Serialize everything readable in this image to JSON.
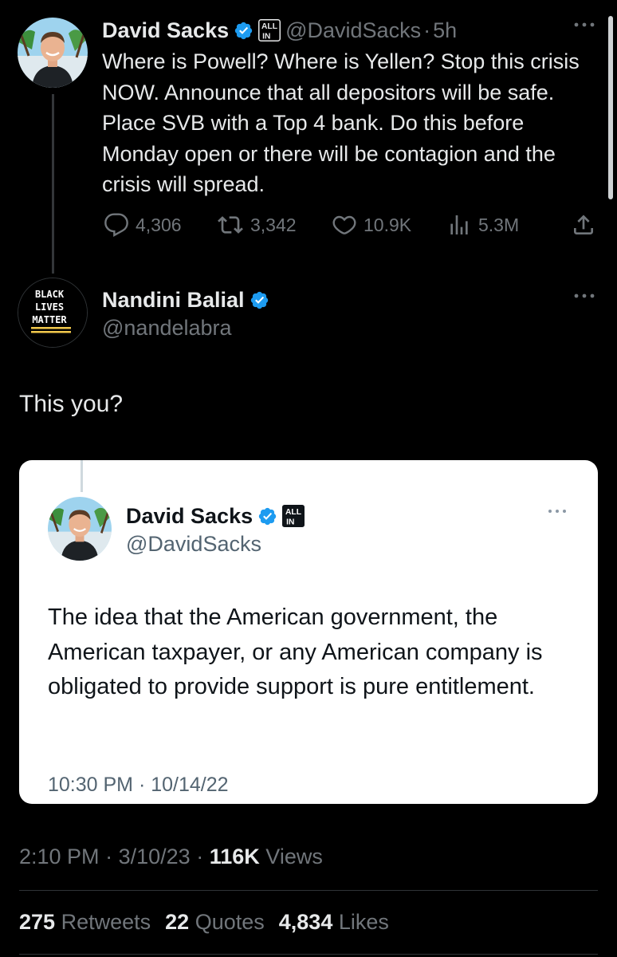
{
  "parent_tweet": {
    "author_name": "David Sacks",
    "badge_label": "ALL IN",
    "handle": "@DavidSacks",
    "separator": "·",
    "time_ago": "5h",
    "text": "Where is Powell? Where is Yellen? Stop this crisis NOW. Announce that all depositors will be safe. Place SVB with a Top 4 bank. Do this before Monday open or there will be contagion and the crisis will spread.",
    "replies": "4,306",
    "retweets": "3,342",
    "likes": "10.9K",
    "views": "5.3M"
  },
  "main_tweet": {
    "author_name": "Nandini Balial",
    "handle": "@nandelabra",
    "avatar_text": [
      "BLACK",
      "LIVES",
      "MATTER"
    ],
    "text": "This you?",
    "time": "2:10 PM",
    "date": "3/10/23",
    "views_count": "116K",
    "views_label": "Views",
    "separator": "·"
  },
  "embedded_tweet": {
    "author_name": "David Sacks",
    "badge_label": "ALL IN",
    "handle": "@DavidSacks",
    "text": "The idea that the American government, the American taxpayer, or any American company is obligated to provide support is pure entitlement.",
    "timestamp": "10:30 PM · 10/14/22"
  },
  "stats": {
    "retweets_count": "275",
    "retweets_label": "Retweets",
    "quotes_count": "22",
    "quotes_label": "Quotes",
    "likes_count": "4,834",
    "likes_label": "Likes"
  },
  "colors": {
    "background": "#000000",
    "text_primary": "#e7e9ea",
    "text_secondary": "#71767b",
    "verified_blue": "#1d9bf0",
    "card_background": "#ffffff"
  },
  "icons": [
    "verified-badge-icon",
    "allin-badge-icon",
    "more-icon",
    "reply-icon",
    "retweet-icon",
    "like-icon",
    "views-icon",
    "share-icon"
  ]
}
